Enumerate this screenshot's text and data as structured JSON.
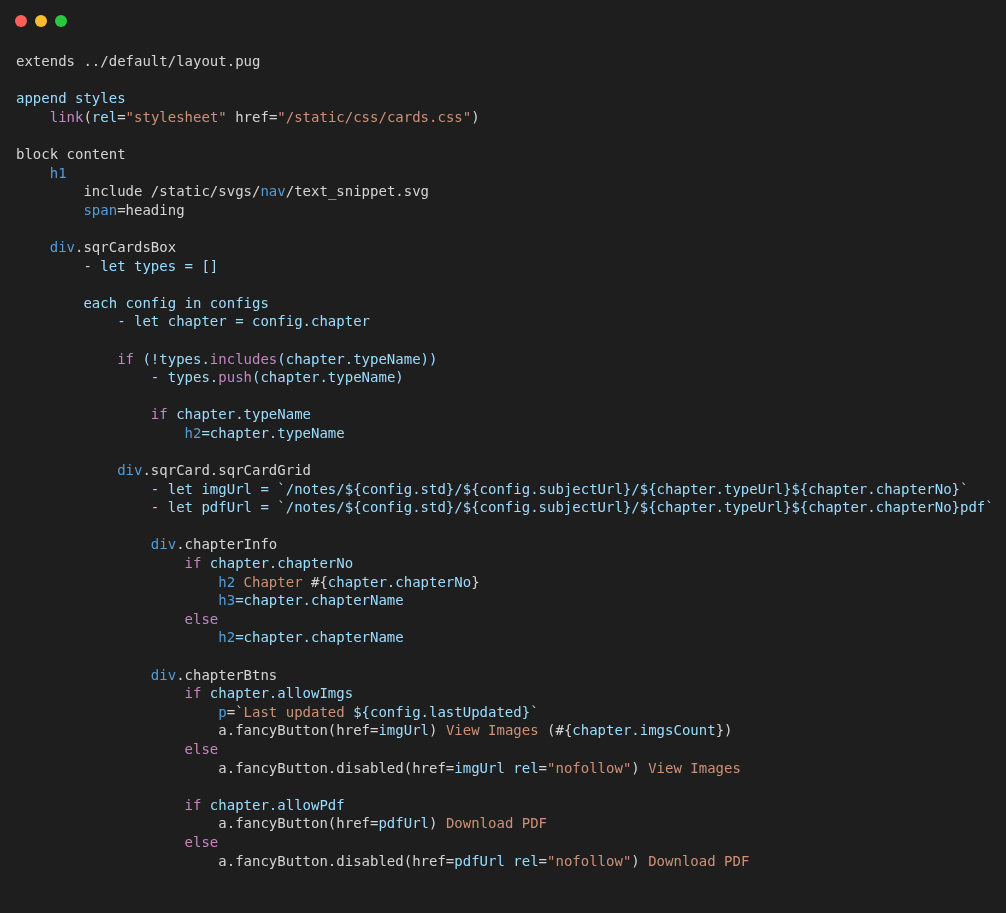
{
  "window": {
    "controls": [
      {
        "color": "#ff5f57"
      },
      {
        "color": "#febc2e"
      },
      {
        "color": "#28c840"
      }
    ]
  },
  "code": [
    {
      "kind": "line",
      "tokens": [
        {
          "kind": "plain",
          "text": "extends ../default/layout.pug"
        }
      ]
    },
    {
      "kind": "blank"
    },
    {
      "kind": "line",
      "tokens": [
        {
          "kind": "var",
          "text": "append styles"
        }
      ],
      "children": [
        {
          "kind": "line",
          "tokens": [
            {
              "kind": "ctrl",
              "text": "link"
            },
            {
              "kind": "plain",
              "text": "("
            },
            {
              "kind": "var",
              "text": "rel"
            },
            {
              "kind": "plain",
              "text": "="
            },
            {
              "kind": "str",
              "text": "\"stylesheet\""
            },
            {
              "kind": "plain",
              "text": " href="
            },
            {
              "kind": "str",
              "text": "\"/static/css/cards.css\""
            },
            {
              "kind": "plain",
              "text": ")"
            }
          ]
        }
      ]
    },
    {
      "kind": "blank"
    },
    {
      "kind": "line",
      "tokens": [
        {
          "kind": "plain",
          "text": "block content"
        }
      ],
      "children": [
        {
          "kind": "line",
          "tokens": [
            {
              "kind": "tag",
              "text": "h1"
            }
          ],
          "children": [
            {
              "kind": "line",
              "tokens": [
                {
                  "kind": "plain",
                  "text": "include /static/svgs/"
                },
                {
                  "kind": "tag",
                  "text": "nav"
                },
                {
                  "kind": "plain",
                  "text": "/text_snippet.svg"
                }
              ]
            },
            {
              "kind": "line",
              "tokens": [
                {
                  "kind": "tag",
                  "text": "span"
                },
                {
                  "kind": "plain",
                  "text": "=heading"
                }
              ]
            }
          ]
        },
        {
          "kind": "blank"
        },
        {
          "kind": "line",
          "tokens": [
            {
              "kind": "tag",
              "text": "div"
            },
            {
              "kind": "plain",
              "text": ".sqrCardsBox"
            }
          ],
          "children": [
            {
              "kind": "line",
              "tokens": [
                {
                  "kind": "var",
                  "text": "- let types = []"
                }
              ]
            },
            {
              "kind": "blank"
            },
            {
              "kind": "line",
              "tokens": [
                {
                  "kind": "var",
                  "text": "each config in configs"
                }
              ],
              "children": [
                {
                  "kind": "line",
                  "tokens": [
                    {
                      "kind": "var",
                      "text": "- let chapter = config.chapter"
                    }
                  ]
                },
                {
                  "kind": "blank"
                },
                {
                  "kind": "line",
                  "tokens": [
                    {
                      "kind": "ctrl",
                      "text": "if"
                    },
                    {
                      "kind": "var",
                      "text": " (!types."
                    },
                    {
                      "kind": "ctrl",
                      "text": "includes"
                    },
                    {
                      "kind": "var",
                      "text": "(chapter.typeName))"
                    }
                  ],
                  "children": [
                    {
                      "kind": "line",
                      "tokens": [
                        {
                          "kind": "var",
                          "text": "- types."
                        },
                        {
                          "kind": "ctrl",
                          "text": "push"
                        },
                        {
                          "kind": "var",
                          "text": "(chapter.typeName)"
                        }
                      ]
                    },
                    {
                      "kind": "blank"
                    },
                    {
                      "kind": "line",
                      "tokens": [
                        {
                          "kind": "ctrl",
                          "text": "if"
                        },
                        {
                          "kind": "var",
                          "text": " chapter.typeName"
                        }
                      ],
                      "children": [
                        {
                          "kind": "line",
                          "tokens": [
                            {
                              "kind": "tag",
                              "text": "h2"
                            },
                            {
                              "kind": "var",
                              "text": "=chapter.typeName"
                            }
                          ]
                        }
                      ]
                    }
                  ]
                },
                {
                  "kind": "blank"
                },
                {
                  "kind": "line",
                  "tokens": [
                    {
                      "kind": "tag",
                      "text": "div"
                    },
                    {
                      "kind": "plain",
                      "text": ".sqrCard.sqrCardGrid"
                    }
                  ],
                  "children": [
                    {
                      "kind": "line",
                      "tokens": [
                        {
                          "kind": "var",
                          "text": "- let imgUrl = `/notes/${config.std}/${config.subjectUrl}/${chapter.typeUrl}${chapter.chapterNo}`"
                        }
                      ]
                    },
                    {
                      "kind": "line",
                      "tokens": [
                        {
                          "kind": "var",
                          "text": "- let pdfUrl = `/notes/${config.std}/${config.subjectUrl}/${chapter.typeUrl}${chapter.chapterNo}pdf`"
                        }
                      ]
                    },
                    {
                      "kind": "blank"
                    },
                    {
                      "kind": "line",
                      "tokens": [
                        {
                          "kind": "tag",
                          "text": "div"
                        },
                        {
                          "kind": "plain",
                          "text": ".chapterInfo"
                        }
                      ],
                      "children": [
                        {
                          "kind": "line",
                          "tokens": [
                            {
                              "kind": "ctrl",
                              "text": "if"
                            },
                            {
                              "kind": "var",
                              "text": " chapter.chapterNo"
                            }
                          ],
                          "children": [
                            {
                              "kind": "line",
                              "tokens": [
                                {
                                  "kind": "tag",
                                  "text": "h2"
                                },
                                {
                                  "kind": "str",
                                  "text": " Chapter "
                                },
                                {
                                  "kind": "plain",
                                  "text": "#{"
                                },
                                {
                                  "kind": "var",
                                  "text": "chapter.chapterNo"
                                },
                                {
                                  "kind": "plain",
                                  "text": "}"
                                }
                              ]
                            },
                            {
                              "kind": "line",
                              "tokens": [
                                {
                                  "kind": "tag",
                                  "text": "h3"
                                },
                                {
                                  "kind": "var",
                                  "text": "=chapter.chapterName"
                                }
                              ]
                            }
                          ]
                        },
                        {
                          "kind": "line",
                          "tokens": [
                            {
                              "kind": "ctrl",
                              "text": "else"
                            }
                          ],
                          "children": [
                            {
                              "kind": "line",
                              "tokens": [
                                {
                                  "kind": "tag",
                                  "text": "h2"
                                },
                                {
                                  "kind": "var",
                                  "text": "=chapter.chapterName"
                                }
                              ]
                            }
                          ]
                        }
                      ]
                    },
                    {
                      "kind": "blank"
                    },
                    {
                      "kind": "line",
                      "tokens": [
                        {
                          "kind": "tag",
                          "text": "div"
                        },
                        {
                          "kind": "plain",
                          "text": ".chapterBtns"
                        }
                      ],
                      "children": [
                        {
                          "kind": "line",
                          "tokens": [
                            {
                              "kind": "ctrl",
                              "text": "if"
                            },
                            {
                              "kind": "var",
                              "text": " chapter.allowImgs"
                            }
                          ],
                          "children": [
                            {
                              "kind": "line",
                              "tokens": [
                                {
                                  "kind": "tag",
                                  "text": "p"
                                },
                                {
                                  "kind": "plain",
                                  "text": "=`"
                                },
                                {
                                  "kind": "str",
                                  "text": "Last updated "
                                },
                                {
                                  "kind": "var",
                                  "text": "${config.lastUpdated}`"
                                }
                              ]
                            },
                            {
                              "kind": "line",
                              "tokens": [
                                {
                                  "kind": "plain",
                                  "text": "a.fancyButton(href="
                                },
                                {
                                  "kind": "var",
                                  "text": "imgUrl"
                                },
                                {
                                  "kind": "plain",
                                  "text": ") "
                                },
                                {
                                  "kind": "str",
                                  "text": "View Images "
                                },
                                {
                                  "kind": "plain",
                                  "text": "(#{"
                                },
                                {
                                  "kind": "var",
                                  "text": "chapter.imgsCount"
                                },
                                {
                                  "kind": "plain",
                                  "text": "})"
                                }
                              ]
                            }
                          ]
                        },
                        {
                          "kind": "line",
                          "tokens": [
                            {
                              "kind": "ctrl",
                              "text": "else"
                            }
                          ],
                          "children": [
                            {
                              "kind": "line",
                              "tokens": [
                                {
                                  "kind": "plain",
                                  "text": "a.fancyButton.disabled(href="
                                },
                                {
                                  "kind": "var",
                                  "text": "imgUrl rel"
                                },
                                {
                                  "kind": "plain",
                                  "text": "="
                                },
                                {
                                  "kind": "str",
                                  "text": "\"nofollow\""
                                },
                                {
                                  "kind": "plain",
                                  "text": ") "
                                },
                                {
                                  "kind": "str",
                                  "text": "View Images"
                                }
                              ]
                            }
                          ]
                        },
                        {
                          "kind": "blank"
                        },
                        {
                          "kind": "line",
                          "tokens": [
                            {
                              "kind": "ctrl",
                              "text": "if"
                            },
                            {
                              "kind": "var",
                              "text": " chapter.allowPdf"
                            }
                          ],
                          "children": [
                            {
                              "kind": "line",
                              "tokens": [
                                {
                                  "kind": "plain",
                                  "text": "a.fancyButton(href="
                                },
                                {
                                  "kind": "var",
                                  "text": "pdfUrl"
                                },
                                {
                                  "kind": "plain",
                                  "text": ") "
                                },
                                {
                                  "kind": "str",
                                  "text": "Download PDF"
                                }
                              ]
                            }
                          ]
                        },
                        {
                          "kind": "line",
                          "tokens": [
                            {
                              "kind": "ctrl",
                              "text": "else"
                            }
                          ],
                          "children": [
                            {
                              "kind": "line",
                              "tokens": [
                                {
                                  "kind": "plain",
                                  "text": "a.fancyButton.disabled(href="
                                },
                                {
                                  "kind": "var",
                                  "text": "pdfUrl rel"
                                },
                                {
                                  "kind": "plain",
                                  "text": "="
                                },
                                {
                                  "kind": "str",
                                  "text": "\"nofollow\""
                                },
                                {
                                  "kind": "plain",
                                  "text": ") "
                                },
                                {
                                  "kind": "str",
                                  "text": "Download PDF"
                                }
                              ]
                            }
                          ]
                        }
                      ]
                    }
                  ]
                }
              ]
            }
          ]
        }
      ]
    }
  ]
}
